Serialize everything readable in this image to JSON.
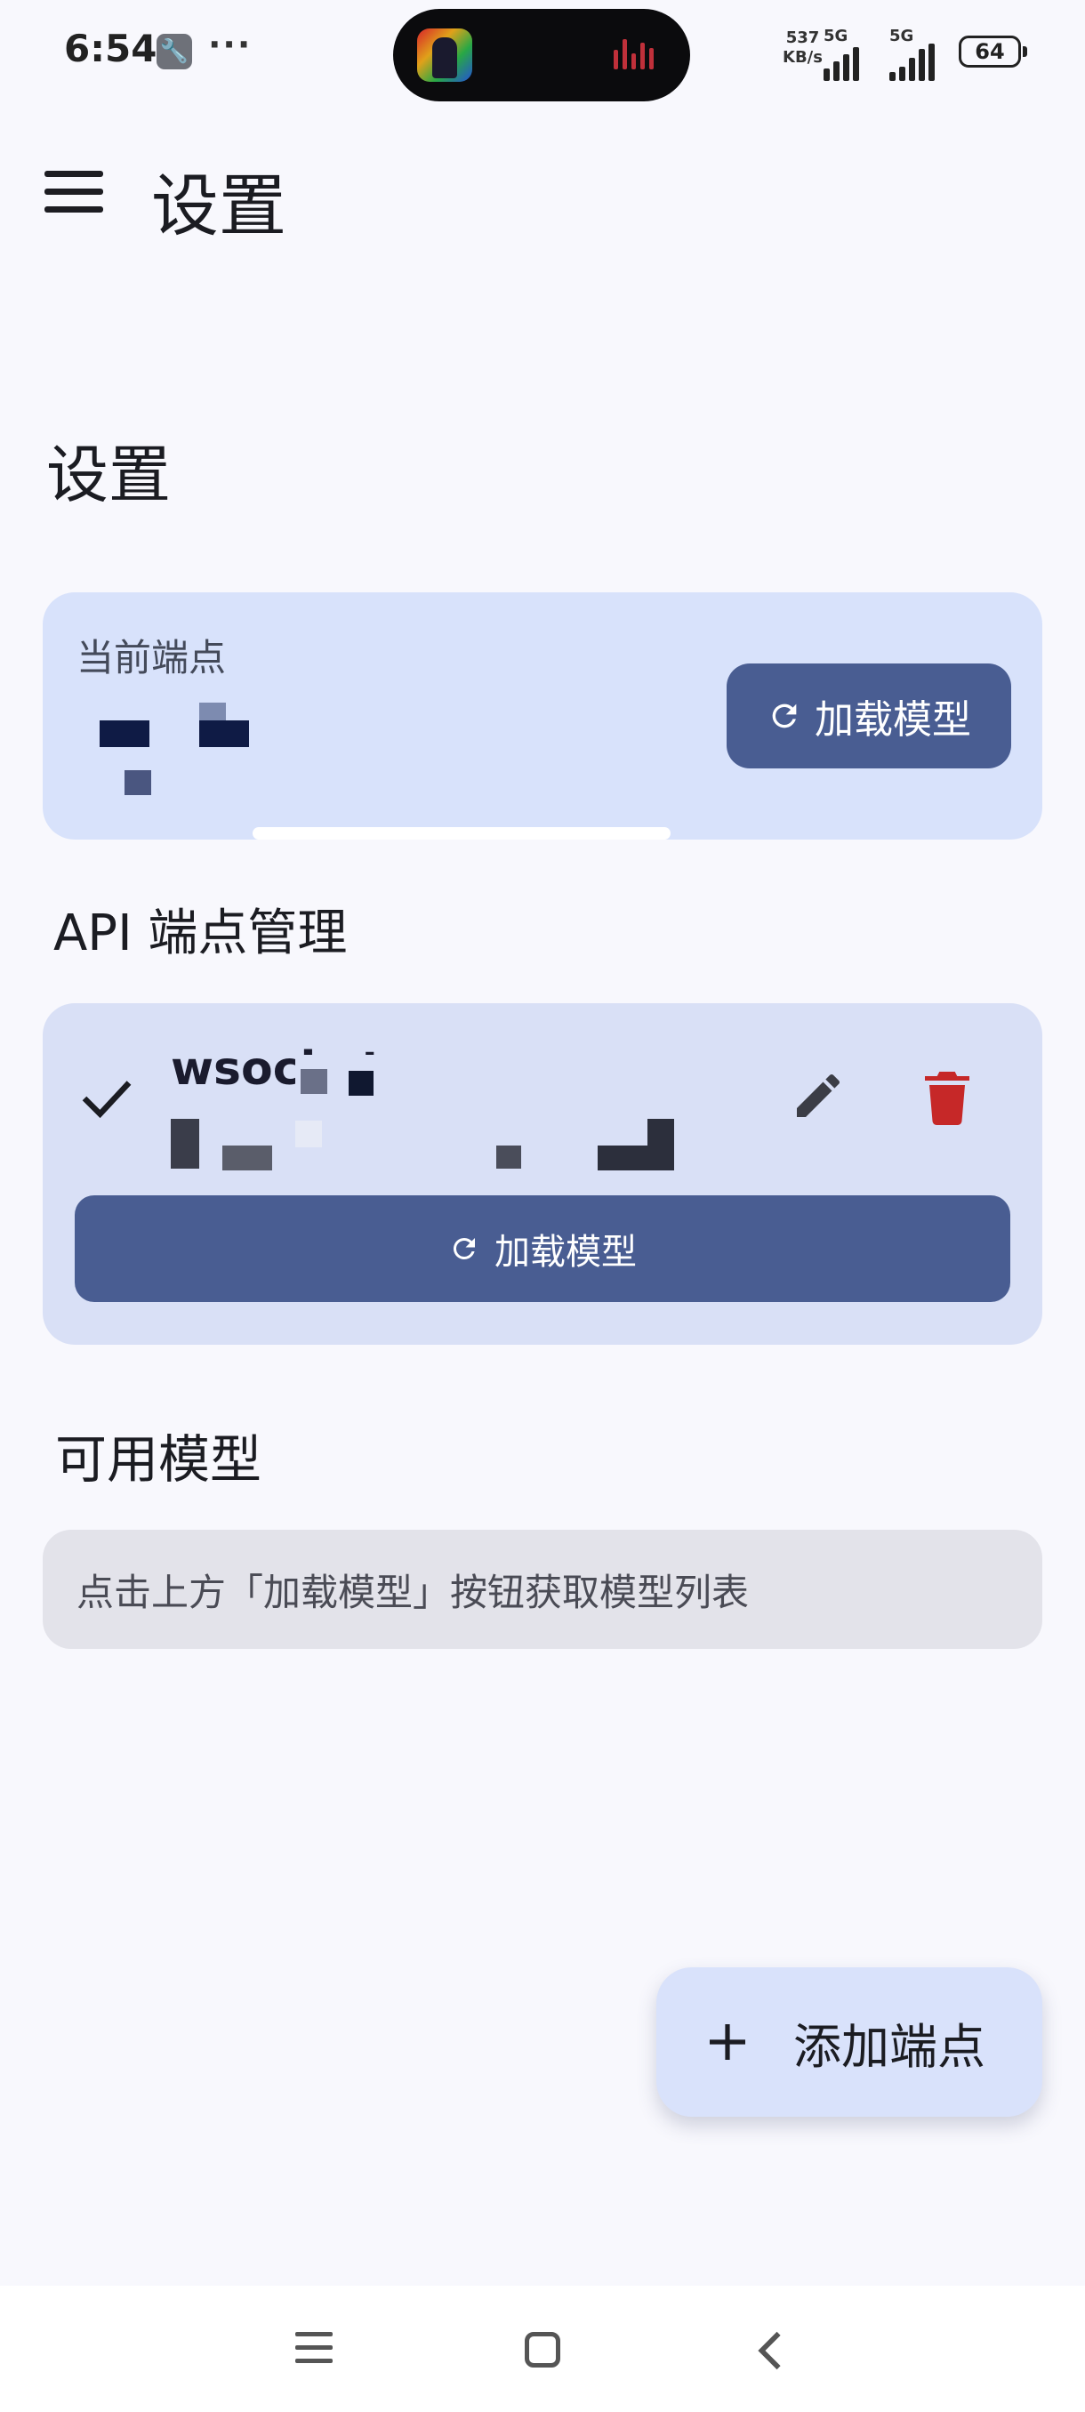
{
  "status_bar": {
    "time": "6:54",
    "overflow": "···",
    "net_speed_value": "537",
    "net_speed_unit": "KB/s",
    "sim1_label": "5G",
    "sim2_label": "5G",
    "battery": "64",
    "icons": [
      "wrench-icon",
      "signal-icon",
      "battery-icon"
    ]
  },
  "app_bar": {
    "title": "设置",
    "menu_icon": "menu-icon"
  },
  "page": {
    "title": "设置"
  },
  "current_endpoint": {
    "label": "当前端点",
    "load_button": "加载模型",
    "load_icon": "refresh-icon"
  },
  "api_section": {
    "title": "API 端点管理",
    "endpoints": [
      {
        "name": "wsocket",
        "selected": true,
        "load_button": "加载模型",
        "edit_icon": "pencil-icon",
        "delete_icon": "trash-icon"
      }
    ]
  },
  "models_section": {
    "title": "可用模型",
    "hint": "点击上方「加载模型」按钮获取模型列表"
  },
  "fab": {
    "label": "添加端点",
    "icon": "plus-icon"
  },
  "nav_bar": {
    "icons": [
      "nav-menu-icon",
      "nav-home-icon",
      "nav-back-icon"
    ]
  },
  "colors": {
    "background": "#f8f8fd",
    "card": "#d8e2fb",
    "button": "#495d92",
    "danger": "#c62828",
    "hint_box": "#e3e3ea"
  }
}
